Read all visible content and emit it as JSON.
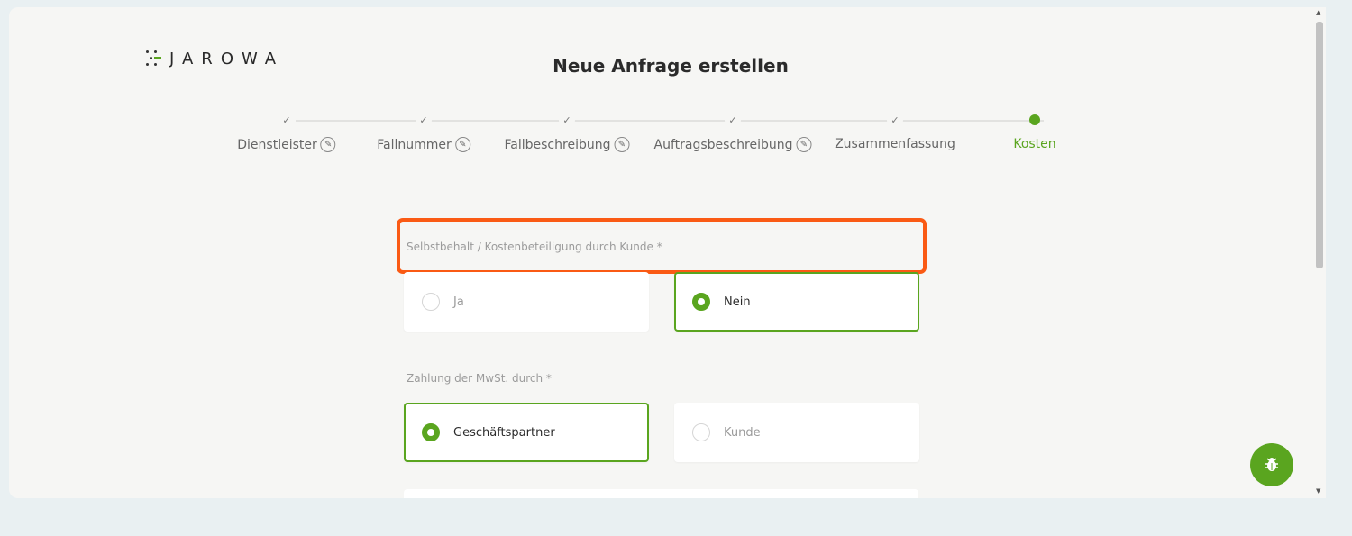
{
  "logo": {
    "text": "JAROWA"
  },
  "header": {
    "title": "Neue Anfrage erstellen"
  },
  "stepper": {
    "steps": [
      {
        "label": "Dienstleister",
        "state": "done",
        "editable": true
      },
      {
        "label": "Fallnummer",
        "state": "done",
        "editable": true
      },
      {
        "label": "Fallbeschreibung",
        "state": "done",
        "editable": true
      },
      {
        "label": "Auftragsbeschreibung",
        "state": "done",
        "editable": true
      },
      {
        "label": "Zusammenfassung",
        "state": "done",
        "editable": false
      },
      {
        "label": "Kosten",
        "state": "active",
        "editable": false
      }
    ]
  },
  "form": {
    "deductible": {
      "label": "Selbstbehalt / Kostenbeteiligung durch Kunde *",
      "options": [
        {
          "label": "Ja",
          "selected": false
        },
        {
          "label": "Nein",
          "selected": true
        }
      ]
    },
    "vat": {
      "label": "Zahlung der MwSt. durch *",
      "options": [
        {
          "label": "Geschäftspartner",
          "selected": true
        },
        {
          "label": "Kunde",
          "selected": false
        }
      ]
    }
  },
  "colors": {
    "accent": "#5aa51f",
    "highlight": "#fa5a14",
    "background": "#e9f0f2",
    "panel": "#f6f6f4"
  },
  "icons": {
    "check": "check-icon",
    "edit": "pencil-circle-icon",
    "bug": "bug-icon"
  }
}
